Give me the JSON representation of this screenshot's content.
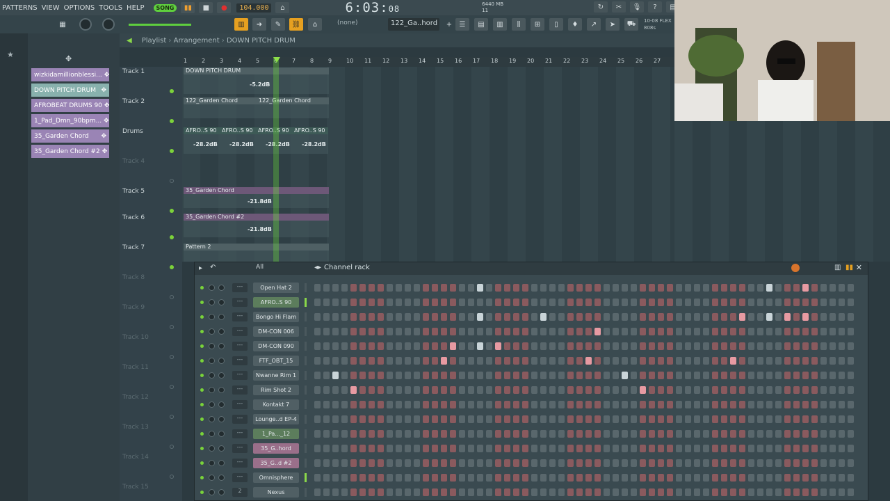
{
  "menu": [
    "PATTERNS",
    "VIEW",
    "OPTIONS",
    "TOOLS",
    "HELP"
  ],
  "song_mode": "SONG",
  "tempo": "104.000",
  "time_main": "6:03",
  "time_sub": "08",
  "memory": "6440 MB",
  "cpu": "11",
  "pattern_none": "(none)",
  "pattern_selected": "122_Ga..hord",
  "breadcrumb": {
    "a": "Playlist",
    "b": "Arrangement",
    "c": "DOWN PITCH DRUM"
  },
  "flex_label": "10-08 FLEX",
  "flex_sub": "808s",
  "patterns": [
    {
      "label": "wizkidamillionblessi...",
      "selected": false
    },
    {
      "label": "DOWN PITCH DRUM",
      "selected": true
    },
    {
      "label": "AFROBEAT DRUMS 90",
      "selected": false
    },
    {
      "label": "1_Pad_Dmn_90bpm...",
      "selected": false
    },
    {
      "label": "35_Garden Chord",
      "selected": false
    },
    {
      "label": "35_Garden Chord #2",
      "selected": false
    }
  ],
  "ruler": [
    "1",
    "2",
    "3",
    "4",
    "5",
    "6",
    "7",
    "8",
    "9",
    "10",
    "11",
    "12",
    "13",
    "14",
    "15",
    "16",
    "17",
    "18",
    "19",
    "20",
    "21",
    "22",
    "23",
    "24",
    "25",
    "26",
    "27"
  ],
  "tracks": [
    {
      "name": "Track 1",
      "dim": false
    },
    {
      "name": "Track 2",
      "dim": false
    },
    {
      "name": "Drums",
      "dim": false
    },
    {
      "name": "Track 4",
      "dim": true
    },
    {
      "name": "Track 5",
      "dim": false
    },
    {
      "name": "Track 6",
      "dim": false
    },
    {
      "name": "Track 7",
      "dim": false
    },
    {
      "name": "Track 8",
      "dim": true
    },
    {
      "name": "Track 9",
      "dim": true
    },
    {
      "name": "Track 10",
      "dim": true
    },
    {
      "name": "Track 11",
      "dim": true
    },
    {
      "name": "Track 12",
      "dim": true
    },
    {
      "name": "Track 13",
      "dim": true
    },
    {
      "name": "Track 14",
      "dim": true
    },
    {
      "name": "Track 15",
      "dim": true
    }
  ],
  "clips": {
    "c1": "DOWN PITCH DRUM",
    "c1_db": "-5.2dB",
    "c2a": "122_Garden Chord",
    "c2b": "122_Garden Chord",
    "c3": "AFRO..S 90",
    "c3_db": "-28.2dB",
    "c5": "35_Garden Chord",
    "c5_db": "-21.8dB",
    "c6": "35_Garden Chord #2",
    "c6_db": "-21.8dB",
    "c7": "Pattern 2"
  },
  "rack": {
    "title": "Channel rack",
    "filter": "All",
    "route_default": "---",
    "route_nexus": "2",
    "channels": [
      {
        "name": "Open Hat 2",
        "style": "plain",
        "level": false,
        "on": [
          18,
          50
        ],
        "pink": [
          54
        ]
      },
      {
        "name": "AFRO..S 90",
        "style": "green",
        "level": true,
        "on": [],
        "pink": []
      },
      {
        "name": "Bongo Hi Flam",
        "style": "plain",
        "level": false,
        "on": [
          18,
          25,
          50
        ],
        "pink": [
          47,
          52,
          54
        ]
      },
      {
        "name": "DM-CON 006",
        "style": "plain",
        "level": false,
        "on": [],
        "pink": [
          31
        ]
      },
      {
        "name": "DM-CON 090",
        "style": "plain",
        "level": false,
        "on": [
          18
        ],
        "pink": [
          15,
          20
        ]
      },
      {
        "name": "FTF_OBT_15",
        "style": "plain",
        "level": false,
        "on": [],
        "pink": [
          14,
          30,
          46
        ]
      },
      {
        "name": "Nwanne Rim 1",
        "style": "plain",
        "level": false,
        "on": [
          2,
          34
        ],
        "pink": []
      },
      {
        "name": "Rim Shot 2",
        "style": "plain",
        "level": false,
        "on": [],
        "pink": [
          4,
          36
        ]
      },
      {
        "name": "Kontakt 7",
        "style": "plain",
        "level": false,
        "on": [],
        "pink": []
      },
      {
        "name": "Lounge..d EP-4",
        "style": "plain",
        "level": false,
        "on": [],
        "pink": []
      },
      {
        "name": "1_Pa..._12",
        "style": "green",
        "level": false,
        "on": [],
        "pink": []
      },
      {
        "name": "35_G..hord",
        "style": "pink",
        "level": false,
        "on": [],
        "pink": []
      },
      {
        "name": "35_G..d #2",
        "style": "pink",
        "level": false,
        "on": [],
        "pink": []
      },
      {
        "name": "Omnisphere",
        "style": "plain",
        "level": true,
        "on": [],
        "pink": []
      },
      {
        "name": "Nexus",
        "style": "plain",
        "level": false,
        "on": [],
        "pink": []
      }
    ]
  }
}
